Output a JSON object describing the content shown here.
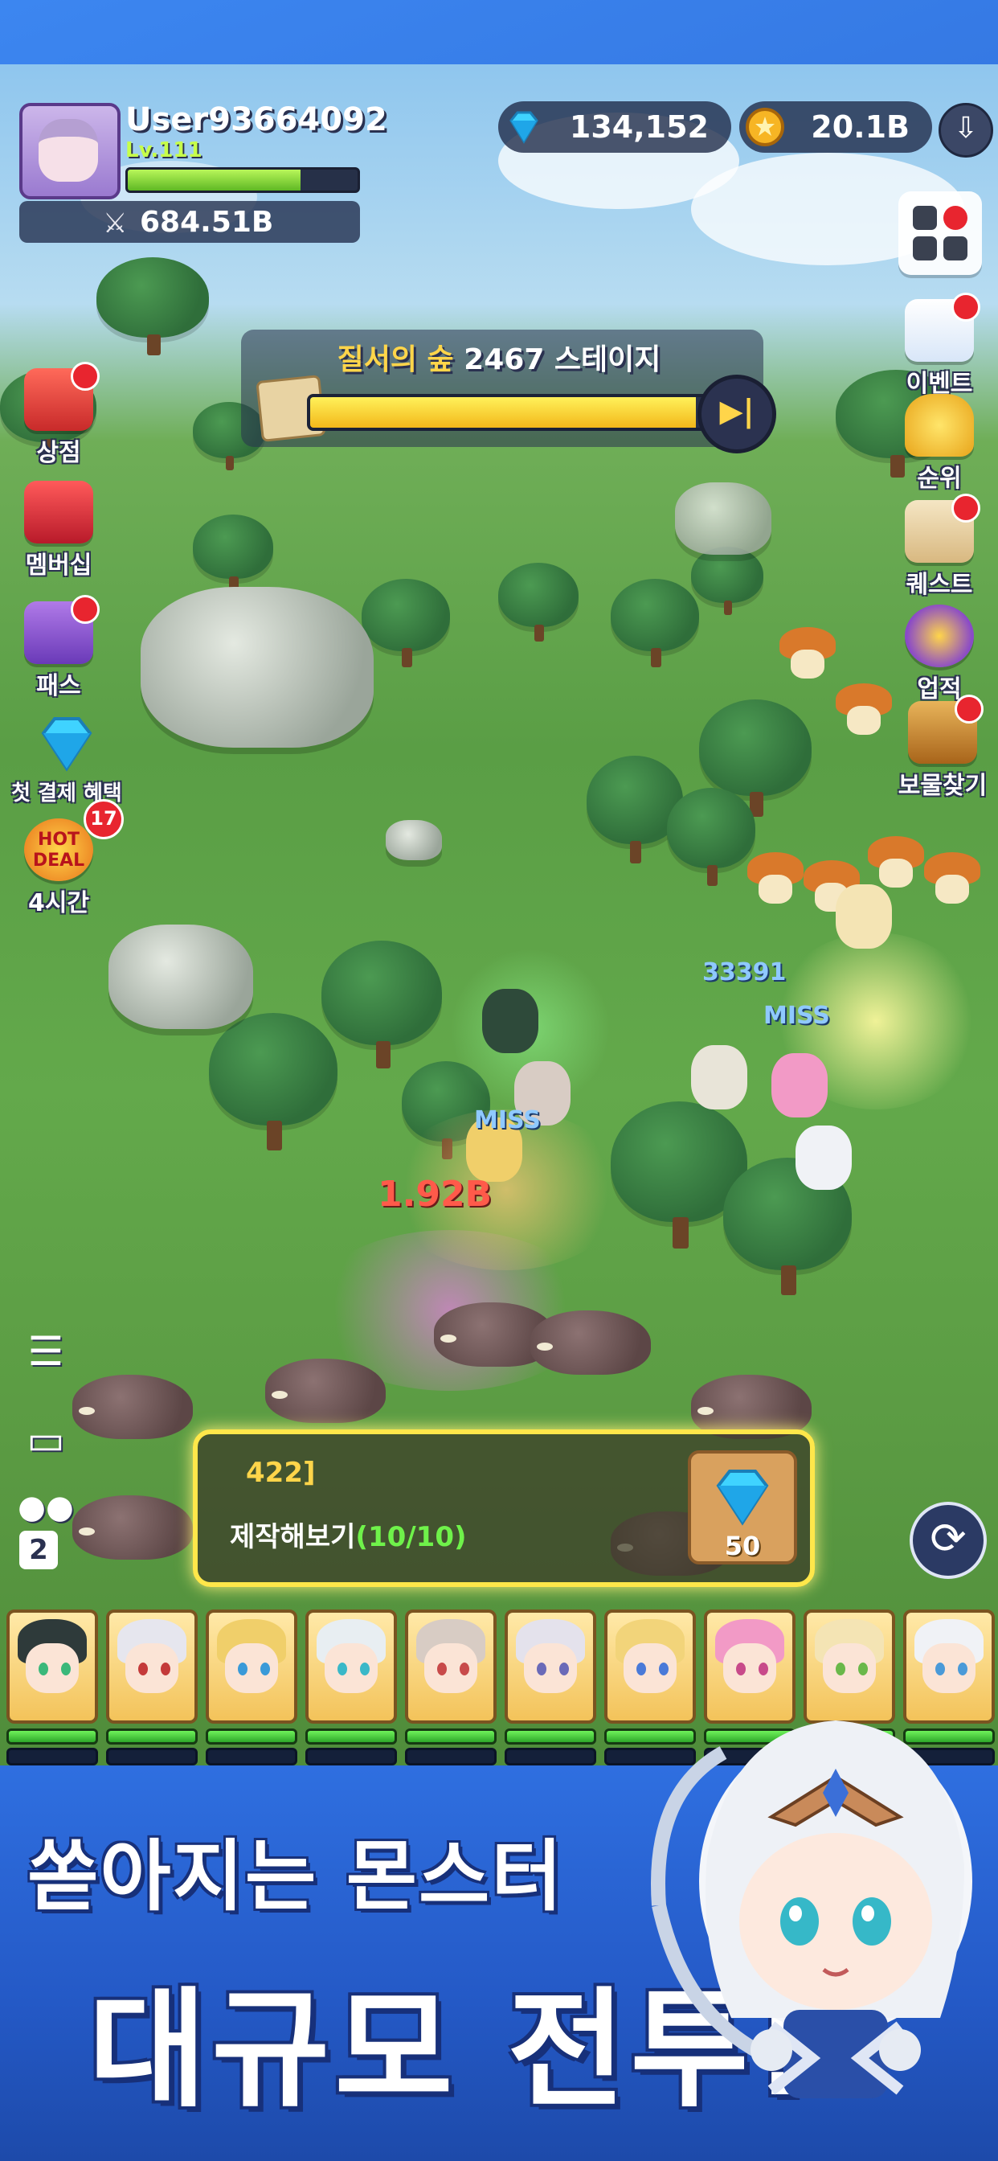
{
  "hud": {
    "username": "User93664092",
    "level": "Lv.111",
    "xp_fraction": 0.75,
    "power": "684.51B",
    "gems": "134,152",
    "coins": "20.1B",
    "download_icon": "arrow-down-icon",
    "menu_icon": "grid-menu-icon"
  },
  "stage": {
    "area_name": "질서의 숲",
    "stage_text": "2467 스테이지",
    "progress_fraction": 0.96,
    "skip_icon": "skip-icon"
  },
  "left_menu": [
    {
      "label": "상점",
      "icon": "shop-icon"
    },
    {
      "label": "멤버십",
      "icon": "gift-icon"
    },
    {
      "label": "패스",
      "icon": "pass-icon"
    },
    {
      "label": "첫 결제 혜택",
      "icon": "diamond-icon"
    },
    {
      "label": "4시간",
      "icon": "hot-deal-icon",
      "badge_text": "HOT DEAL",
      "badge_count": "17"
    }
  ],
  "right_menu": [
    {
      "label": "이벤트",
      "icon": "calendar-icon"
    },
    {
      "label": "순위",
      "icon": "trophy-icon"
    },
    {
      "label": "퀘스트",
      "icon": "scroll-icon"
    },
    {
      "label": "업적",
      "icon": "medal-icon"
    },
    {
      "label": "보물찾기",
      "icon": "treasure-chest-icon"
    }
  ],
  "battle_text": {
    "damage_big": "1.92B",
    "damage_small": "33391",
    "miss1": "MISS",
    "miss2": "MISS"
  },
  "tools": {
    "speed_value": "2",
    "list_icon": "list-icon",
    "chest_icon": "chest-icon",
    "party_icon": "party-icon"
  },
  "quest": {
    "code": "422]",
    "text": "제작해보기",
    "progress": "(10/10)",
    "reward_amount": "50",
    "reward_icon": "diamond-icon"
  },
  "refresh_icon": "refresh-icon",
  "heroes": [
    {
      "hair": "#2e3a3a",
      "eye": "#3ab87a",
      "mp": 0.0
    },
    {
      "hair": "#e6e6ee",
      "eye": "#c43a3a",
      "mp": 0.0
    },
    {
      "hair": "#f0cf6a",
      "eye": "#3a9ad8",
      "mp": 0.0
    },
    {
      "hair": "#e8eef2",
      "eye": "#3ab8c8",
      "mp": 0.0
    },
    {
      "hair": "#d8ccc4",
      "eye": "#c84a4a",
      "mp": 0.0
    },
    {
      "hair": "#e4e2ec",
      "eye": "#6a6ab8",
      "mp": 0.0
    },
    {
      "hair": "#f2d47a",
      "eye": "#4a7ad8",
      "mp": 0.0
    },
    {
      "hair": "#f29ac6",
      "eye": "#c84a8a",
      "mp": 0.0
    },
    {
      "hair": "#f4e4b4",
      "eye": "#6ab84a",
      "mp": 0.0
    },
    {
      "hair": "#f0f2f6",
      "eye": "#4a9ad8",
      "mp": 0.0
    }
  ],
  "promo": {
    "line1": "쏟아지는 몬스터",
    "line2": "대규모 전투!"
  },
  "colors": {
    "gem": "#3fd3ff",
    "coin": "#f7b524",
    "accent_yellow": "#ffd54a",
    "promo_blue": "#2f6fe0"
  }
}
